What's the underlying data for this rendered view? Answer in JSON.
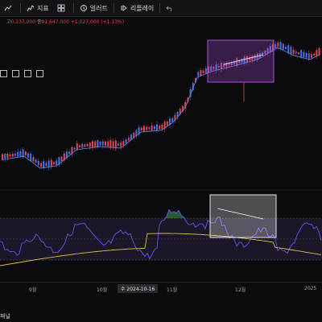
{
  "toolbar": {
    "items": [
      {
        "label": "",
        "icon": "chart-type-icon"
      },
      {
        "label": "지표",
        "icon": "indicators-icon"
      },
      {
        "label": "",
        "icon": "layout-icon"
      },
      {
        "label": "얼러트",
        "icon": "alert-icon"
      },
      {
        "label": "",
        "icon": "replay-separator-icon"
      },
      {
        "label": "리플레이",
        "icon": "replay-icon"
      },
      {
        "label": "",
        "icon": "undo-icon"
      }
    ]
  },
  "ohlc": {
    "high_key": "고",
    "high_value": "0,237,000",
    "close_key": "종",
    "close_value": "91,647,000",
    "change": "+1,027,000 (+1.13%)"
  },
  "xaxis": {
    "labels": [
      "9월",
      "10월",
      "11월",
      "12월",
      "2025"
    ],
    "cursor_label": "수 2024-10-16"
  },
  "footer": {
    "text": "패널"
  },
  "colors": {
    "up": "#e0464b",
    "down": "#4a6fe3",
    "ma": "#5b7fd6",
    "rsi": "#6a5cff",
    "signal": "#d8c34a",
    "box_purple": "#b14ee0",
    "box_white": "#e5e5e5"
  }
}
